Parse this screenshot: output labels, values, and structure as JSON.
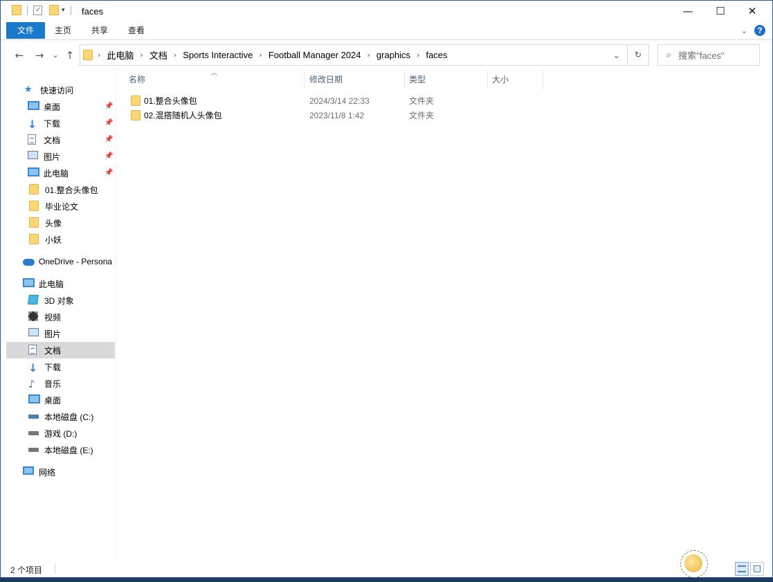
{
  "window": {
    "title": "faces",
    "minimize_glyph": "—",
    "maximize_glyph": "☐",
    "close_glyph": "✕"
  },
  "ribbon": {
    "tabs": [
      "文件",
      "主页",
      "共享",
      "查看"
    ]
  },
  "navigation": {
    "back": "←",
    "forward": "→",
    "recent": "⌄",
    "up": "↑",
    "breadcrumbs": [
      "此电脑",
      "文档",
      "Sports Interactive",
      "Football Manager 2024",
      "graphics",
      "faces"
    ],
    "search_placeholder": "搜索\"faces\""
  },
  "sidebar": {
    "quick_access": {
      "label": "快速访问",
      "items": [
        {
          "label": "桌面",
          "icon": "desktop-icon",
          "pinned": true
        },
        {
          "label": "下载",
          "icon": "download-icon",
          "pinned": true
        },
        {
          "label": "文档",
          "icon": "documents-icon",
          "pinned": true
        },
        {
          "label": "图片",
          "icon": "pictures-icon",
          "pinned": true
        },
        {
          "label": "此电脑",
          "icon": "computer-icon",
          "pinned": true
        },
        {
          "label": "01.整合头像包",
          "icon": "folder-icon",
          "pinned": false
        },
        {
          "label": "毕业论文",
          "icon": "folder-icon",
          "pinned": false
        },
        {
          "label": "头像",
          "icon": "folder-icon",
          "pinned": false
        },
        {
          "label": "小妖",
          "icon": "folder-icon",
          "pinned": false
        }
      ]
    },
    "onedrive": {
      "label": "OneDrive - Persona"
    },
    "this_pc": {
      "label": "此电脑",
      "items": [
        {
          "label": "3D 对象",
          "icon": "3d-objects-icon"
        },
        {
          "label": "视频",
          "icon": "videos-icon"
        },
        {
          "label": "图片",
          "icon": "pictures-icon"
        },
        {
          "label": "文档",
          "icon": "documents-icon",
          "selected": true
        },
        {
          "label": "下载",
          "icon": "download-icon"
        },
        {
          "label": "音乐",
          "icon": "music-icon"
        },
        {
          "label": "桌面",
          "icon": "desktop-icon"
        },
        {
          "label": "本地磁盘 (C:)",
          "icon": "system-drive-icon"
        },
        {
          "label": "游戏 (D:)",
          "icon": "drive-icon"
        },
        {
          "label": "本地磁盘 (E:)",
          "icon": "drive-icon"
        }
      ]
    },
    "network": {
      "label": "网络"
    }
  },
  "columns": {
    "name": "名称",
    "date": "修改日期",
    "type": "类型",
    "size": "大小"
  },
  "files": [
    {
      "name": "01.整合头像包",
      "date": "2024/3/14 22:33",
      "type": "文件夹"
    },
    {
      "name": "02.混搭随机人头像包",
      "date": "2023/11/8 1:42",
      "type": "文件夹"
    }
  ],
  "status": {
    "item_count": "2 个项目"
  }
}
